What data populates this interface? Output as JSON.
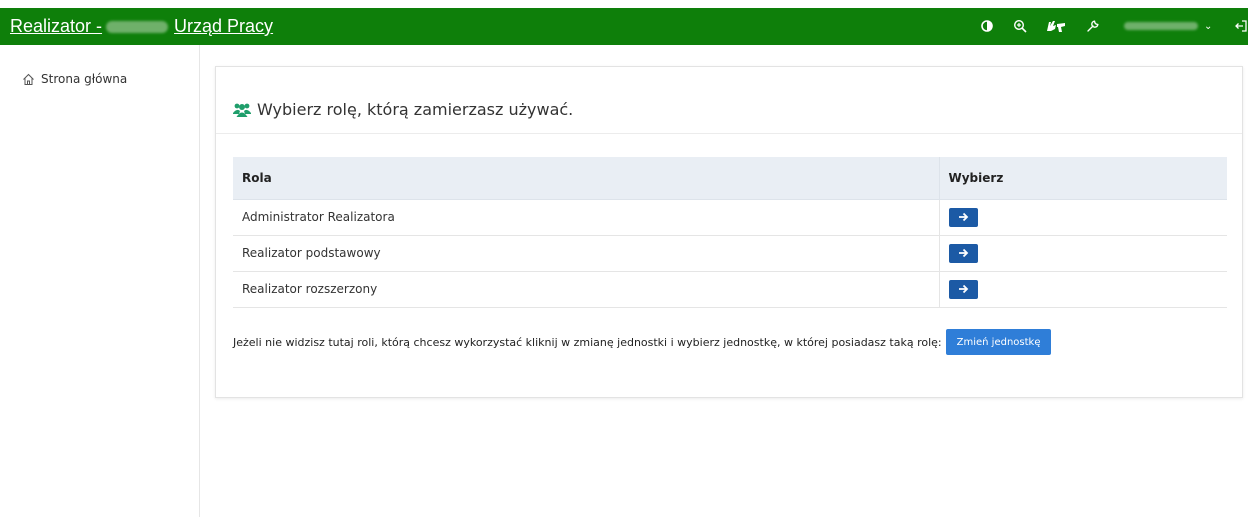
{
  "header": {
    "brand_prefix": "Realizator -",
    "brand_suffix": "Urząd Pracy",
    "bg_color": "#0e7f0a",
    "icons": [
      "contrast-icon",
      "zoom-icon",
      "sign-language-icon",
      "wrench-icon",
      "logout-icon"
    ]
  },
  "sidebar": {
    "items": [
      {
        "label": "Strona główna",
        "icon": "home-icon"
      }
    ]
  },
  "main": {
    "title": "Wybierz rolę, którą zamierzasz używać.",
    "title_icon": "users-icon",
    "table": {
      "columns": [
        "Rola",
        "Wybierz"
      ],
      "rows": [
        {
          "role": "Administrator Realizatora"
        },
        {
          "role": "Realizator podstawowy"
        },
        {
          "role": "Realizator rozszerzony"
        }
      ],
      "select_icon": "arrow-right-icon",
      "select_color": "#1c5aa5"
    },
    "info_text": "Jeżeli nie widzisz tutaj roli, którą chcesz wykorzystać kliknij w zmianę jednostki i wybierz jednostkę, w której posiadasz taką rolę:",
    "change_unit_label": "Zmień jednostkę",
    "change_unit_color": "#2f7ed8"
  }
}
